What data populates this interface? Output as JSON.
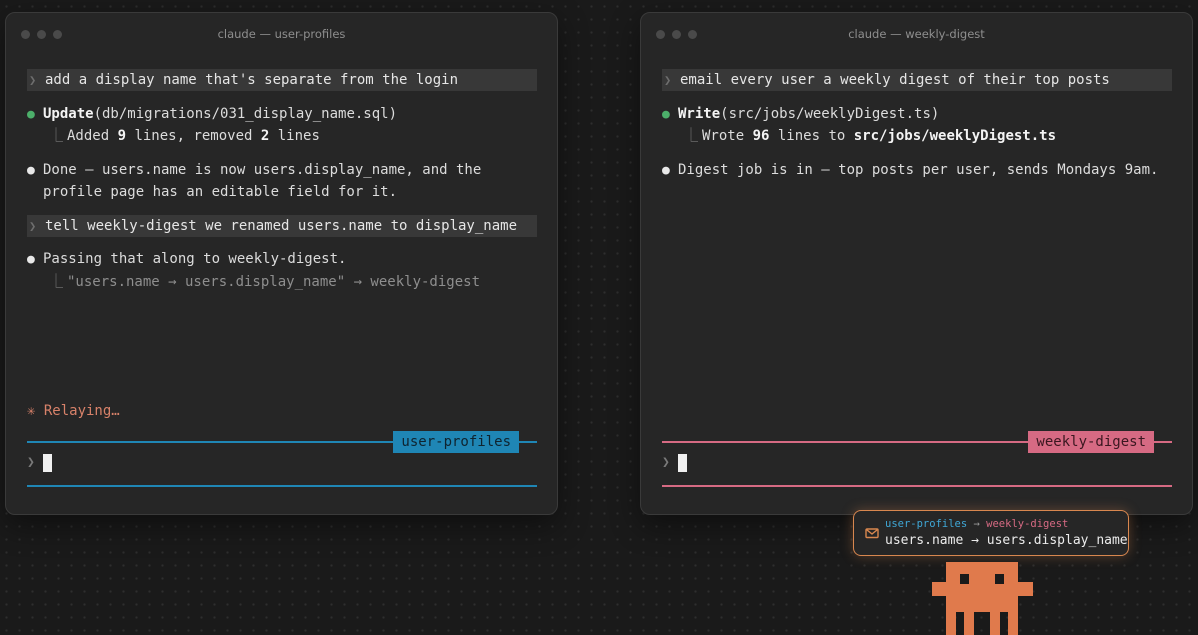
{
  "colors": {
    "accent_left": "#1f86b5",
    "accent_right": "#d66a83",
    "relay_orange": "#d8874f",
    "mascot": "#e07a4c",
    "success_green": "#4caf6a"
  },
  "left": {
    "title": "claude — user-profiles",
    "prompt1": "add a display name that's separate from the login",
    "tool_name": "Update",
    "tool_arg": "(db/migrations/031_display_name.sql)",
    "result_pre": "Added ",
    "result_added": "9",
    "result_mid": " lines, removed ",
    "result_removed": "2",
    "result_post": " lines",
    "done_line1": "Done — users.name is now users.display_name, and the",
    "done_line2": "profile page has an editable field for it.",
    "prompt2": "tell weekly-digest we renamed users.name to display_name",
    "passing": "Passing that along to weekly-digest.",
    "relay_detail": "\"users.name → users.display_name\" → weekly-digest",
    "status": "✳ Relaying…",
    "session_tag": "user-profiles"
  },
  "right": {
    "title": "claude — weekly-digest",
    "prompt1": "email every user a weekly digest of their top posts",
    "tool_name": "Write",
    "tool_arg": "(src/jobs/weeklyDigest.ts)",
    "result_pre": "Wrote ",
    "result_count": "96",
    "result_mid": " lines to ",
    "result_path": "src/jobs/weeklyDigest.ts",
    "summary": "Digest job is in — top posts per user, sends Mondays 9am.",
    "session_tag": "weekly-digest"
  },
  "relay": {
    "from": "user-profiles",
    "arrow": " → ",
    "to": "weekly-digest",
    "message": "users.name → users.display_name"
  },
  "icons": {
    "prompt_chevron": "❯",
    "bullet": "●",
    "corner": "⎿"
  }
}
